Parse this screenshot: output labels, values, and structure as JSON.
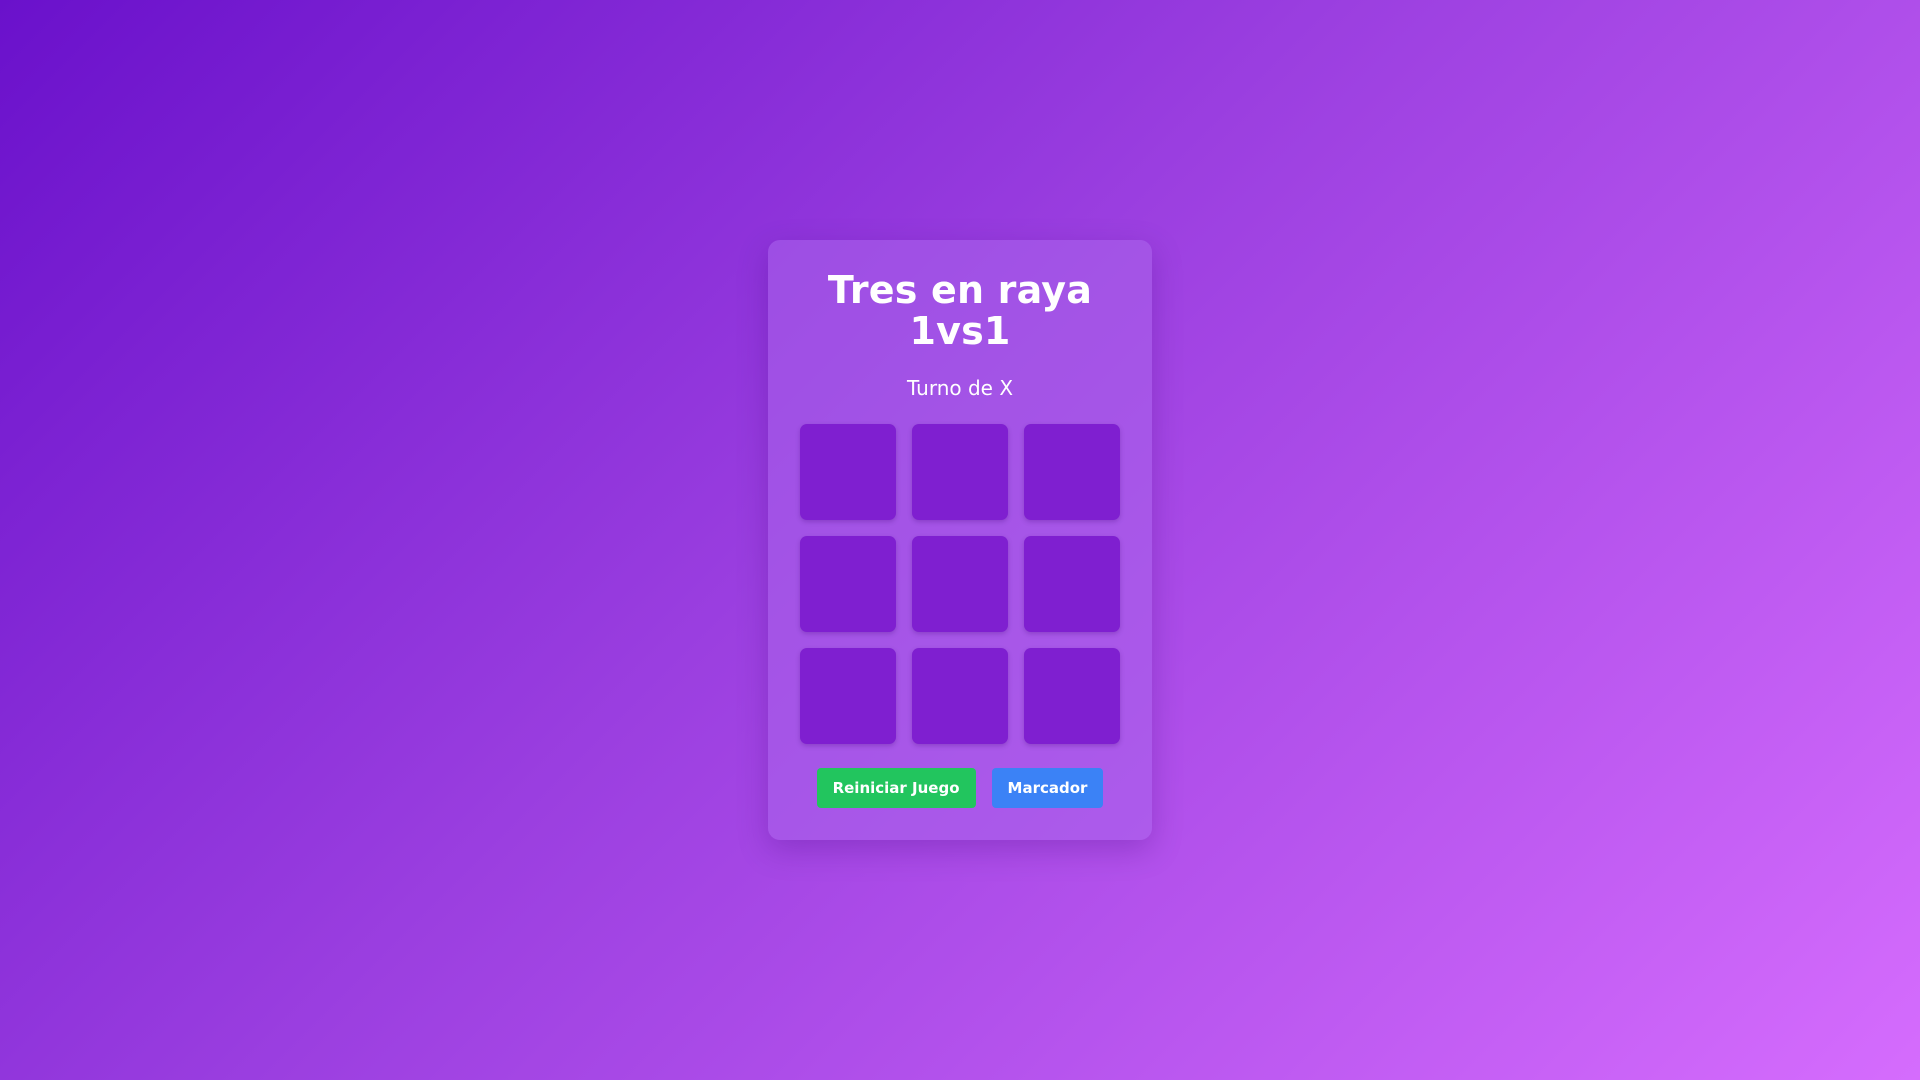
{
  "game": {
    "title_line1": "Tres en raya",
    "title_line2": "1vs1",
    "status": "Turno de X",
    "cells": [
      "",
      "",
      "",
      "",
      "",
      "",
      "",
      "",
      ""
    ]
  },
  "buttons": {
    "restart_label": "Reiniciar Juego",
    "score_label": "Marcador"
  },
  "colors": {
    "background_start": "#6a11cb",
    "background_end": "#d56cfd",
    "cell": "#7f1fd0",
    "restart_button": "#22c55e",
    "score_button": "#3b82f6"
  }
}
